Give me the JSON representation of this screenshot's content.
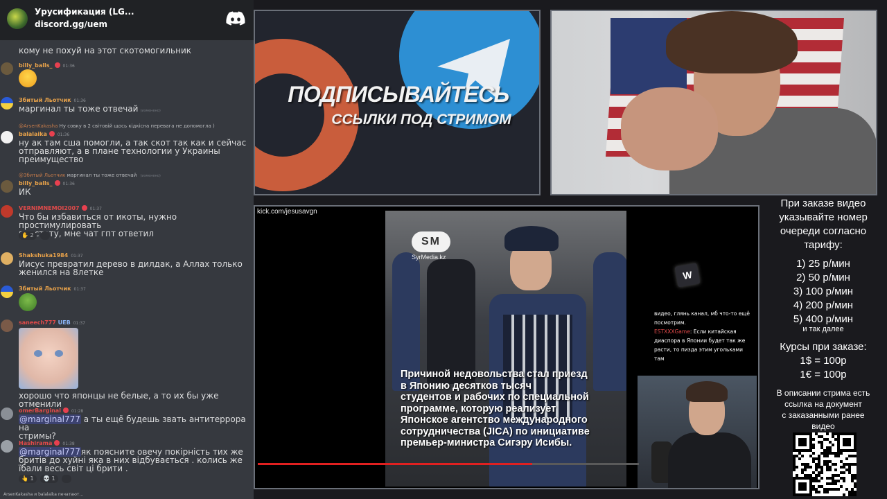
{
  "server": {
    "name": "Урусификация (LG...",
    "invite": "discord.gg/uem"
  },
  "messages": {
    "m0": {
      "text": "кому не похуй на этот скотомогильник"
    },
    "m1": {
      "author": "billy_balls_",
      "time": "01:36"
    },
    "m2": {
      "author": "Збитый Льотчик",
      "time": "01:36",
      "text": "маргинал ты тоже отвечай",
      "edited": "(изменено)"
    },
    "m3": {
      "reply_author": "@ArsenKakasha",
      "reply_text": "Ну совку в 2 світовій щось кідкісна перевага не допомогла )",
      "author": "balalaika",
      "time": "01:36",
      "text": "ну ак там сша помогли, а так скот так как и сейчас\nотправляют, а в плане технологии у Украины\nпреимущество"
    },
    "m4": {
      "reply_author": "@Збитый Льотчик",
      "reply_text": "маргинал ты тоже отвечай",
      "reply_edited": "(изменено)",
      "author": "billy_balls_",
      "time": "01:36",
      "text": "ИК"
    },
    "m5": {
      "author": "VERNIMNEMOI2007",
      "time": "01:37",
      "text": "Что бы избавиться от икоты, нужно простимулировать\nпростату, мне чат гпт ответил",
      "reaction_count": "2"
    },
    "m6": {
      "author": "Shakshuka1984",
      "time": "01:37",
      "text": "Иисус превратил дерево в дилдак, а Аллах только\nженился на 8летке"
    },
    "m7": {
      "author": "Збитый Льотчик",
      "time": "01:37"
    },
    "m8": {
      "author": "saneech777",
      "tag": "UEB",
      "time": "01:37",
      "text": "хорошо что японцы не белые, а то их бы уже отменили"
    },
    "m9": {
      "author": "omerBarginal",
      "time": "01:28",
      "mention": "@marginal777",
      "text": "а ты ещё будешь звать антитеррора на\nстримы?"
    },
    "m10": {
      "author": "Hashirama",
      "time": "01:38",
      "mention": "@marginal777",
      "text": "як поясните овечу покірність тих же\nбритів до хуйні яка в них відбувається .  колись же\nїбали весь світ  ці брити .",
      "reaction_a": "1",
      "reaction_b": "1"
    }
  },
  "typing": "ArsenKakasha и balalaika печатают...",
  "promo": {
    "title": "ПОДПИСЫВАЙТЕСЬ",
    "subtitle": "ССЫЛКИ ПОД СТРИМОМ"
  },
  "player": {
    "url": "kick.com/jesusavgn",
    "logo_letters": "SM",
    "logo_label": "SyrMedia.kz",
    "subtitle": "Причиной недовольства стал приезд\nв Японию десятков тысяч\nстудентов и рабочих по специальной\nпрограмме, которую реализует\nЯпонское агентство международного\nсотрудничества (JICA) по инициативе\nпремьер-министра Сигэру Исибы.",
    "progress": 0.72,
    "chat_icon": "W",
    "chat_line1": "видео, глянь канал, мб что-то ещё посмотрим.",
    "chat_author": "ESTXXXGame",
    "chat_line2": ": Если китайская диаспора в Японии будет так же расти, то пизда этим угольками там"
  },
  "info": {
    "heading": "При заказе видео\nуказывайте номер\nочереди согласно\nтарифу:",
    "tariffs": [
      "1) 25 р/мин",
      "2) 50 р/мин",
      "3) 100 р/мин",
      "4) 200 р/мин",
      "5) 400 р/мин"
    ],
    "more": "и так далее",
    "rates_title": "Курсы при заказе:",
    "rates": [
      "1$ = 100р",
      "1€ = 100р"
    ],
    "description": "В описании стрима есть\nссылка на документ\nс заказанными ранее\nвидео"
  },
  "colors": {
    "chat_bg": "#36393f",
    "header_bg": "#202225",
    "mention_bg": "#3c4270",
    "progress": "#e02020",
    "author_red": "#e24a4a",
    "author_orange": "#e8a24a"
  }
}
